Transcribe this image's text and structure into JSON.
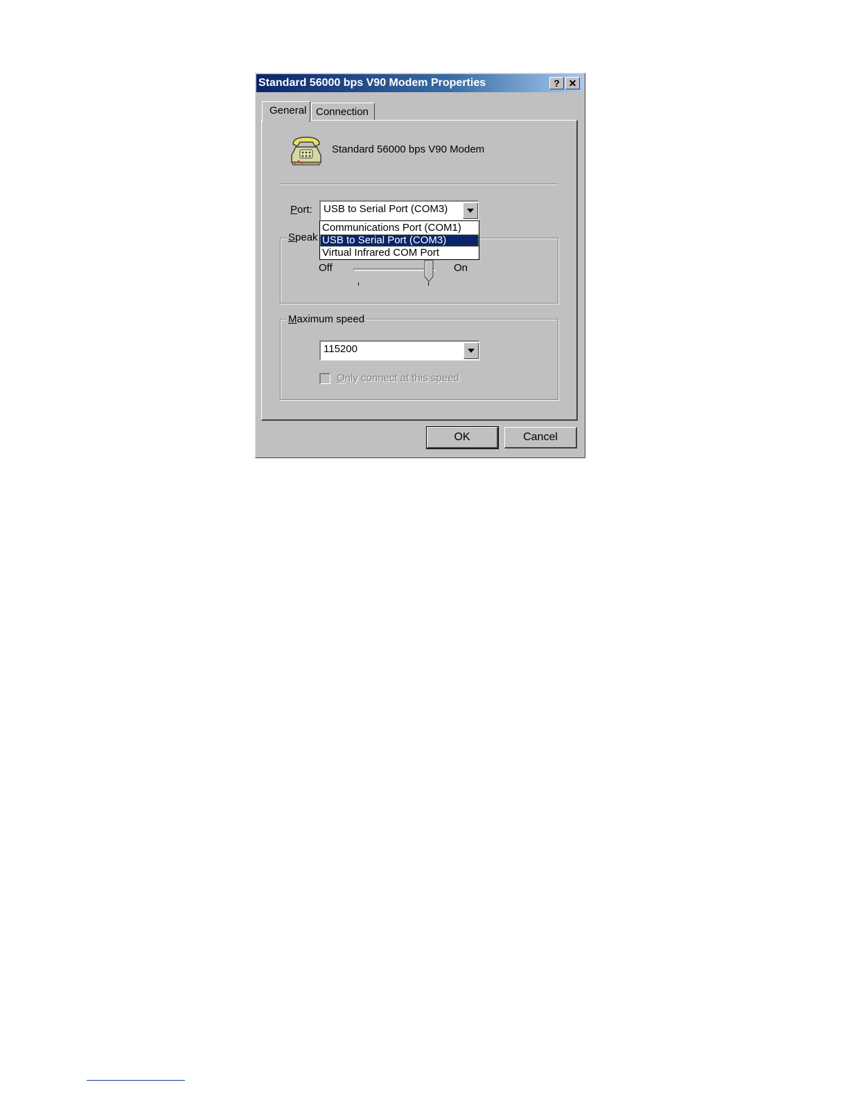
{
  "window": {
    "title": "Standard 56000 bps V90 Modem Properties",
    "help_glyph": "?",
    "close_glyph": "✕"
  },
  "tabs": [
    {
      "label": "General",
      "active": true
    },
    {
      "label": "Connection",
      "active": false
    }
  ],
  "device": {
    "name": "Standard 56000 bps V90 Modem",
    "icon": "telephone-modem-icon"
  },
  "port": {
    "label_accel": "P",
    "label_rest": "ort:",
    "value": "USB to Serial Port (COM3)",
    "options": [
      "Communications Port (COM1)",
      "USB to Serial Port (COM3)",
      "Virtual Infrared COM Port"
    ],
    "selected_index": 1
  },
  "speaker": {
    "legend_accel": "S",
    "legend_rest": "peak",
    "off_label": "Off",
    "on_label": "On",
    "level": 1.0
  },
  "max_speed": {
    "legend_accel": "M",
    "legend_rest": "aximum speed",
    "value": "115200",
    "only_connect_accel": "O",
    "only_connect_rest": "nly connect at this speed",
    "only_connect_checked": false,
    "only_connect_enabled": false
  },
  "buttons": {
    "ok": "OK",
    "cancel": "Cancel"
  },
  "colors": {
    "title_bar": "#0a246a",
    "face": "#c0c0c0",
    "selection": "#0a246a"
  }
}
